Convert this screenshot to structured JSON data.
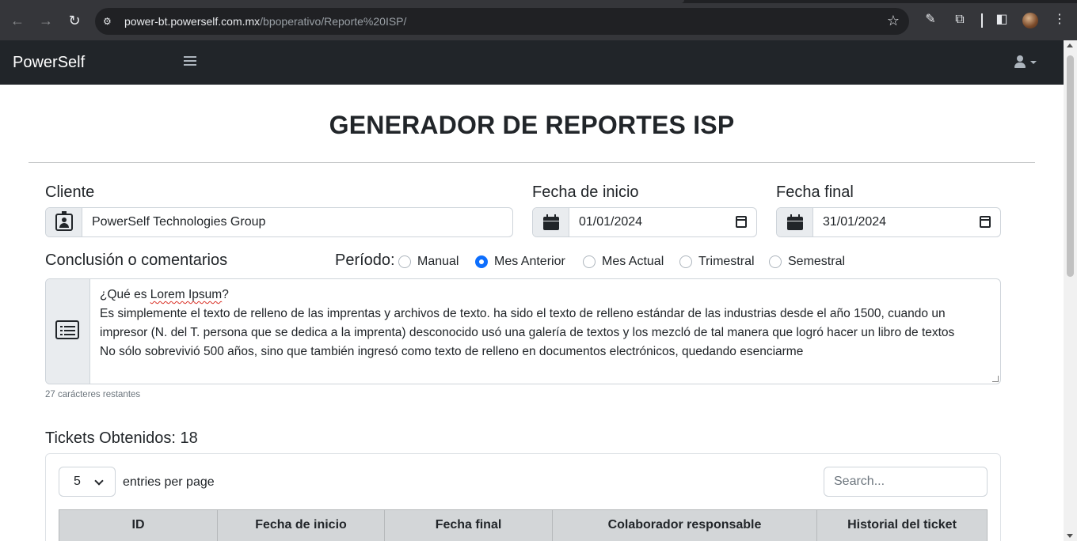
{
  "browser": {
    "url_host": "power-bt.powerself.com.mx",
    "url_path": "/bpoperativo/Reporte%20ISP/"
  },
  "navbar": {
    "brand": "PowerSelf"
  },
  "page": {
    "title": "GENERADOR DE REPORTES ISP"
  },
  "form": {
    "cliente_label": "Cliente",
    "cliente_value": "PowerSelf Technologies Group",
    "fecha_inicio_label": "Fecha de inicio",
    "fecha_inicio_value": "01/01/2024",
    "fecha_final_label": "Fecha final",
    "fecha_final_value": "31/01/2024",
    "comentarios_label": "Conclusión o comentarios",
    "periodo_label": "Período:",
    "periodo_options": [
      "Manual",
      "Mes Anterior",
      "Mes Actual",
      "Trimestral",
      "Semestral"
    ],
    "periodo_selected": "Mes Anterior",
    "comentario_line1_a": "¿Qué es ",
    "comentario_line1_b": "Lorem Ipsum",
    "comentario_line1_c": "?",
    "comentario_line2": "Es simplemente el texto de relleno de las imprentas y archivos de texto. ha sido el texto de relleno estándar de las industrias desde el año 1500, cuando un",
    "comentario_line3": "impresor (N. del T. persona que se dedica a la imprenta) desconocido usó una galería de textos y los mezcló de tal manera que logró hacer un libro de textos",
    "comentario_line4": "No sólo sobrevivió 500 años, sino que también ingresó como texto de relleno en documentos electrónicos, quedando esenciarme",
    "caracteres_restantes": "27 carácteres restantes"
  },
  "tickets": {
    "title": "Tickets Obtenidos: 18",
    "page_size": "5",
    "entries_label": "entries per page",
    "search_placeholder": "Search...",
    "columns": [
      "ID",
      "Fecha de inicio",
      "Fecha final",
      "Colaborador responsable",
      "Historial del ticket"
    ]
  },
  "colors": {
    "navbar_bg": "#212529",
    "accent": "#0d6efd",
    "addon_bg": "#e9ecef",
    "thead_bg": "#d3d6d8"
  }
}
